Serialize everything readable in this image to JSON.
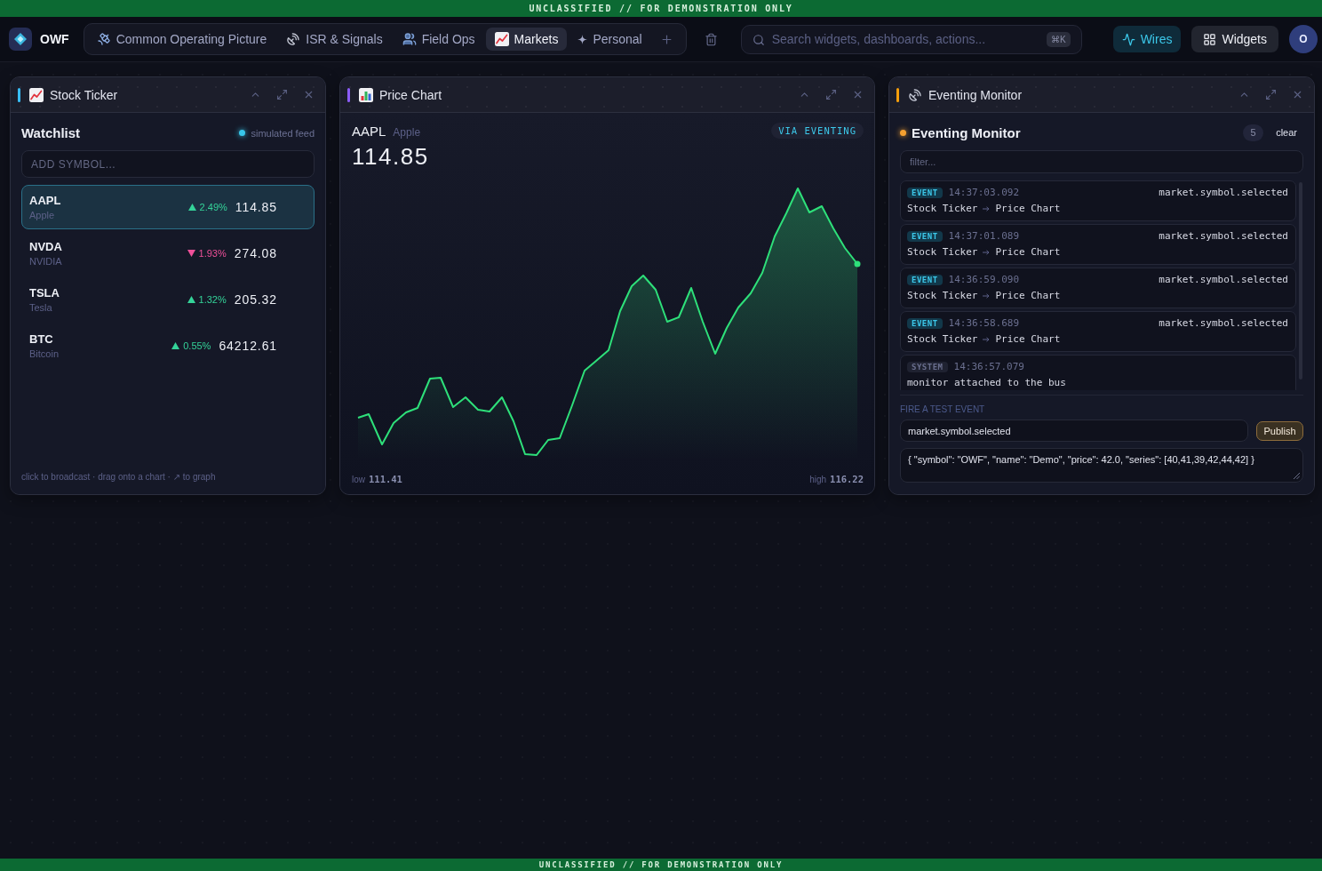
{
  "top_banner": "UNCLASSIFIED // FOR DEMONSTRATION ONLY",
  "header": {
    "brand": "OWF",
    "tabs": [
      {
        "label": "Common Operating Picture",
        "selected": false
      },
      {
        "label": "ISR & Signals",
        "selected": false
      },
      {
        "label": "Field Ops",
        "selected": false
      },
      {
        "label": "Markets",
        "selected": true
      },
      {
        "label": "Personal",
        "selected": false
      }
    ],
    "search": {
      "placeholder": "Search widgets, dashboards, actions...",
      "shortcut": "⌘K"
    },
    "buttons": [
      {
        "label": "Wires",
        "active": true
      },
      {
        "label": "Widgets",
        "active": false
      }
    ],
    "avatar": "O"
  },
  "widgets": [
    {
      "kind": "ticker",
      "title": "Stock Ticker",
      "color": "#38bdf8",
      "heading": "Watchlist",
      "feed_status": "simulated feed",
      "add_symbol": {
        "placeholder": "ADD SYMBOL..."
      },
      "rows": [
        {
          "symbol": "AAPL",
          "name": "Apple",
          "rising": true,
          "change": "2.49%",
          "price": "114.85",
          "selected": true
        },
        {
          "symbol": "NVDA",
          "name": "NVIDIA",
          "rising": false,
          "change": "1.93%",
          "price": "274.08",
          "selected": false
        },
        {
          "symbol": "TSLA",
          "name": "Tesla",
          "rising": true,
          "change": "1.32%",
          "price": "205.32",
          "selected": false
        },
        {
          "symbol": "BTC",
          "name": "Bitcoin",
          "rising": true,
          "change": "0.55%",
          "price": "64212.61",
          "selected": false
        }
      ],
      "footer": "click to broadcast · drag onto a chart · ↗ to graph"
    },
    {
      "kind": "chart",
      "title": "Price Chart",
      "color": "#8b5cf6",
      "symbol": "AAPL",
      "name": "Apple",
      "price": "114.85",
      "source_badge": "VIA EVENTING",
      "low_label": "low",
      "low": "111.41",
      "high_label": "high",
      "high": "116.22"
    },
    {
      "kind": "monitor",
      "title": "Eventing Monitor",
      "color": "#f59e0b",
      "heading": "Eventing Monitor",
      "count": "5",
      "clear_button": "clear",
      "filter": {
        "placeholder": "filter..."
      },
      "events": [
        {
          "kind": "event",
          "badge": "EVENT",
          "time": "14:37:03.092",
          "topic": "market.symbol.selected",
          "source": "Stock Ticker",
          "target": "Price Chart"
        },
        {
          "kind": "event",
          "badge": "EVENT",
          "time": "14:37:01.089",
          "topic": "market.symbol.selected",
          "source": "Stock Ticker",
          "target": "Price Chart"
        },
        {
          "kind": "event",
          "badge": "EVENT",
          "time": "14:36:59.090",
          "topic": "market.symbol.selected",
          "source": "Stock Ticker",
          "target": "Price Chart"
        },
        {
          "kind": "event",
          "badge": "EVENT",
          "time": "14:36:58.689",
          "topic": "market.symbol.selected",
          "source": "Stock Ticker",
          "target": "Price Chart"
        },
        {
          "kind": "system",
          "badge": "SYSTEM",
          "time": "14:36:57.079",
          "message": "monitor attached to the bus"
        }
      ],
      "test_event": {
        "label": "FIRE A TEST EVENT",
        "topic": "market.symbol.selected",
        "button": "Publish",
        "payload": "{ \"symbol\": \"OWF\", \"name\": \"Demo\", \"price\": 42.0, \"series\": [40,41,39,42,44,42] }"
      }
    }
  ],
  "bottom_banner": "UNCLASSIFIED // FOR DEMONSTRATION ONLY"
}
